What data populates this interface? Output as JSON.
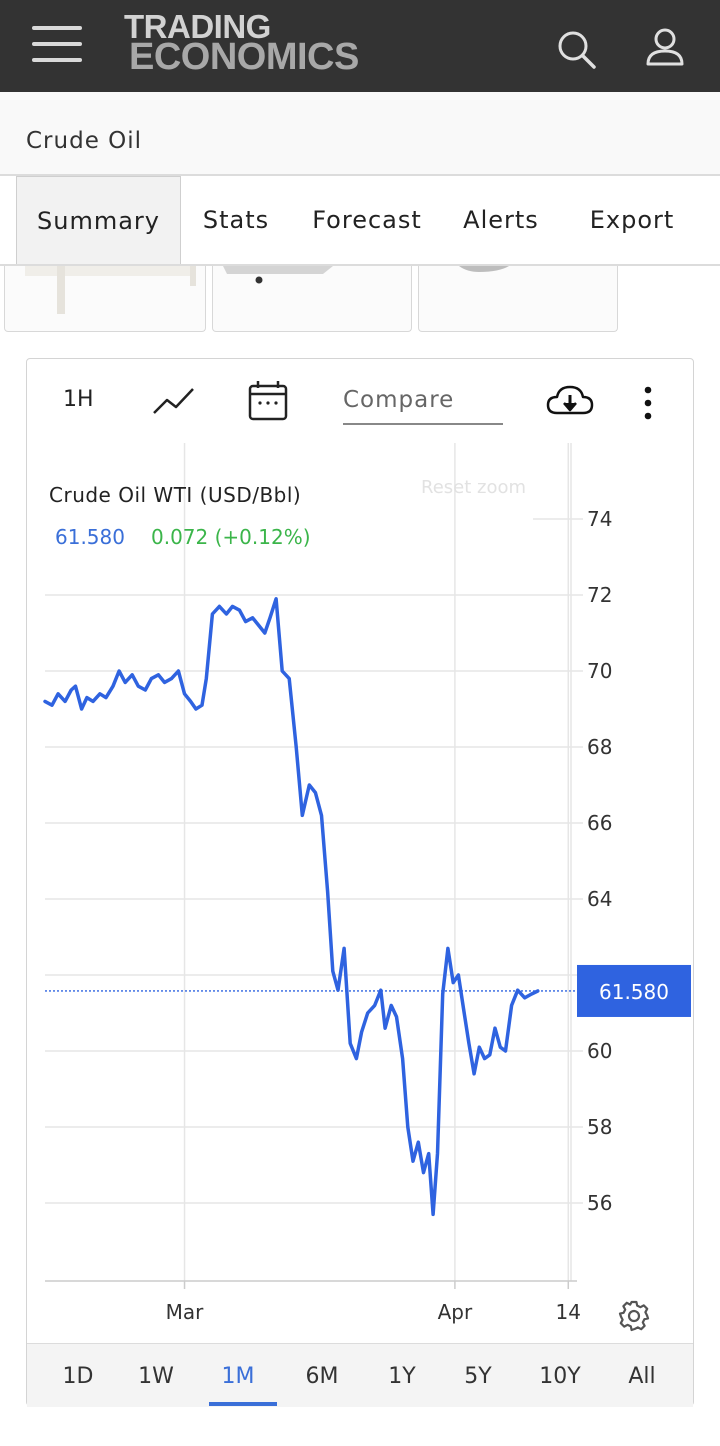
{
  "header": {
    "logo_line1": "TRADING",
    "logo_line2": "ECONOMICS",
    "menu_icon": "hamburger-icon",
    "search_icon": "search-icon",
    "user_icon": "user-icon"
  },
  "page": {
    "title": "Crude Oil"
  },
  "tabs": [
    {
      "label": "Summary",
      "active": true
    },
    {
      "label": "Stats"
    },
    {
      "label": "Forecast"
    },
    {
      "label": "Alerts"
    },
    {
      "label": "Export"
    }
  ],
  "toolbar": {
    "interval_label": "1H",
    "chart_type_icon": "line-chart-icon",
    "calendar_icon": "calendar-icon",
    "compare_placeholder": "Compare",
    "download_icon": "cloud-download-icon",
    "more_icon": "more-vertical-icon"
  },
  "chart_info": {
    "series_name": "Crude Oil WTI (USD/Bbl)",
    "last_value": "61.580",
    "change": "0.072 (+0.12%)",
    "reset_zoom": "Reset zoom",
    "price_tag": "61.580",
    "settings_icon": "gear-icon"
  },
  "colors": {
    "line": "#2f63e0",
    "price_tag": "#2f63e0",
    "positive": "#3bb54a",
    "active_range": "#3a6fd8",
    "header_bg": "#333333"
  },
  "chart_data": {
    "type": "line",
    "title": "Crude Oil WTI (USD/Bbl)",
    "y_ticks": [
      56,
      58,
      60,
      62,
      64,
      66,
      68,
      70,
      72,
      74
    ],
    "y_tick_labels": [
      "56",
      "58",
      "60",
      "",
      "64",
      "66",
      "68",
      "70",
      "72",
      "74"
    ],
    "ylim": [
      54,
      77
    ],
    "x_ticks": [
      {
        "label": "Mar",
        "day": 16
      },
      {
        "label": "Apr",
        "day": 47
      },
      {
        "label": "14",
        "day": 60
      }
    ],
    "xlim": [
      0,
      61
    ],
    "last_price": 61.58,
    "series": [
      {
        "name": "Crude Oil WTI",
        "points": [
          [
            0,
            69.2
          ],
          [
            0.8,
            69.1
          ],
          [
            1.5,
            69.4
          ],
          [
            2.3,
            69.2
          ],
          [
            3,
            69.5
          ],
          [
            3.5,
            69.6
          ],
          [
            4.2,
            69.0
          ],
          [
            4.8,
            69.3
          ],
          [
            5.5,
            69.2
          ],
          [
            6.3,
            69.4
          ],
          [
            7,
            69.3
          ],
          [
            7.8,
            69.6
          ],
          [
            8.5,
            70.0
          ],
          [
            9.2,
            69.7
          ],
          [
            10,
            69.9
          ],
          [
            10.7,
            69.6
          ],
          [
            11.5,
            69.5
          ],
          [
            12.2,
            69.8
          ],
          [
            13,
            69.9
          ],
          [
            13.7,
            69.7
          ],
          [
            14.5,
            69.8
          ],
          [
            15.3,
            70.0
          ],
          [
            16,
            69.4
          ],
          [
            16.7,
            69.2
          ],
          [
            17.3,
            69.0
          ],
          [
            18,
            69.1
          ],
          [
            18.5,
            69.8
          ],
          [
            19.2,
            71.5
          ],
          [
            20,
            71.7
          ],
          [
            20.8,
            71.5
          ],
          [
            21.5,
            71.7
          ],
          [
            22.3,
            71.6
          ],
          [
            23,
            71.3
          ],
          [
            23.8,
            71.4
          ],
          [
            24.5,
            71.2
          ],
          [
            25.2,
            71.0
          ],
          [
            25.8,
            71.4
          ],
          [
            26.5,
            71.9
          ],
          [
            27.2,
            70.0
          ],
          [
            28,
            69.8
          ],
          [
            28.8,
            68.0
          ],
          [
            29.5,
            66.2
          ],
          [
            30.3,
            67.0
          ],
          [
            31,
            66.8
          ],
          [
            31.7,
            66.2
          ],
          [
            32.4,
            64.2
          ],
          [
            33,
            62.1
          ],
          [
            33.6,
            61.6
          ],
          [
            34.3,
            62.7
          ],
          [
            35,
            60.2
          ],
          [
            35.7,
            59.8
          ],
          [
            36.3,
            60.5
          ],
          [
            37,
            61.0
          ],
          [
            37.8,
            61.2
          ],
          [
            38.5,
            61.6
          ],
          [
            39,
            60.6
          ],
          [
            39.7,
            61.2
          ],
          [
            40.3,
            60.9
          ],
          [
            41,
            59.8
          ],
          [
            41.6,
            58.0
          ],
          [
            42.2,
            57.1
          ],
          [
            42.8,
            57.6
          ],
          [
            43.4,
            56.8
          ],
          [
            44.0,
            57.3
          ],
          [
            44.5,
            55.7
          ],
          [
            45.0,
            57.3
          ],
          [
            45.6,
            61.5
          ],
          [
            46.2,
            62.7
          ],
          [
            46.8,
            61.8
          ],
          [
            47.4,
            62.0
          ],
          [
            48.0,
            61.1
          ],
          [
            48.6,
            60.2
          ],
          [
            49.2,
            59.4
          ],
          [
            49.8,
            60.1
          ],
          [
            50.4,
            59.8
          ],
          [
            51.0,
            59.9
          ],
          [
            51.6,
            60.6
          ],
          [
            52.2,
            60.1
          ],
          [
            52.8,
            60.0
          ],
          [
            53.5,
            61.2
          ],
          [
            54.2,
            61.6
          ],
          [
            55,
            61.4
          ],
          [
            55.8,
            61.5
          ],
          [
            56.5,
            61.58
          ]
        ]
      }
    ],
    "grid": true
  },
  "ranges": [
    {
      "label": "1D"
    },
    {
      "label": "1W"
    },
    {
      "label": "1M",
      "active": true
    },
    {
      "label": "6M"
    },
    {
      "label": "1Y"
    },
    {
      "label": "5Y"
    },
    {
      "label": "10Y"
    },
    {
      "label": "All"
    }
  ]
}
